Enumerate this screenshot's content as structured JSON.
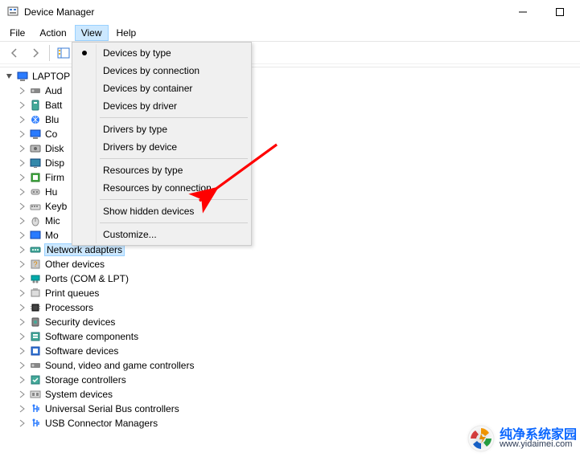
{
  "title": "Device Manager",
  "menus": {
    "file": "File",
    "action": "Action",
    "view": "View",
    "help": "Help"
  },
  "view_menu": {
    "by_type": "Devices by type",
    "by_conn": "Devices by connection",
    "by_cont": "Devices by container",
    "by_drv": "Devices by driver",
    "drv_type": "Drivers by type",
    "drv_dev": "Drivers by device",
    "res_type": "Resources by type",
    "res_conn": "Resources by connection",
    "show_hidden": "Show hidden devices",
    "customize": "Customize..."
  },
  "root": "LAPTOP",
  "nodes": [
    {
      "label": "Aud"
    },
    {
      "label": "Batt"
    },
    {
      "label": "Blu"
    },
    {
      "label": "Co"
    },
    {
      "label": "Disk"
    },
    {
      "label": "Disp"
    },
    {
      "label": "Firm"
    },
    {
      "label": "Hu"
    },
    {
      "label": "Keyb"
    },
    {
      "label": "Mic"
    },
    {
      "label": "Mo"
    },
    {
      "label": "Network adapters",
      "selected": true
    },
    {
      "label": "Other devices"
    },
    {
      "label": "Ports (COM & LPT)"
    },
    {
      "label": "Print queues"
    },
    {
      "label": "Processors"
    },
    {
      "label": "Security devices"
    },
    {
      "label": "Software components"
    },
    {
      "label": "Software devices"
    },
    {
      "label": "Sound, video and game controllers"
    },
    {
      "label": "Storage controllers"
    },
    {
      "label": "System devices"
    },
    {
      "label": "Universal Serial Bus controllers"
    },
    {
      "label": "USB Connector Managers"
    }
  ],
  "watermark": {
    "cn": "纯净系统家园",
    "url": "www.yidaimei.com"
  }
}
